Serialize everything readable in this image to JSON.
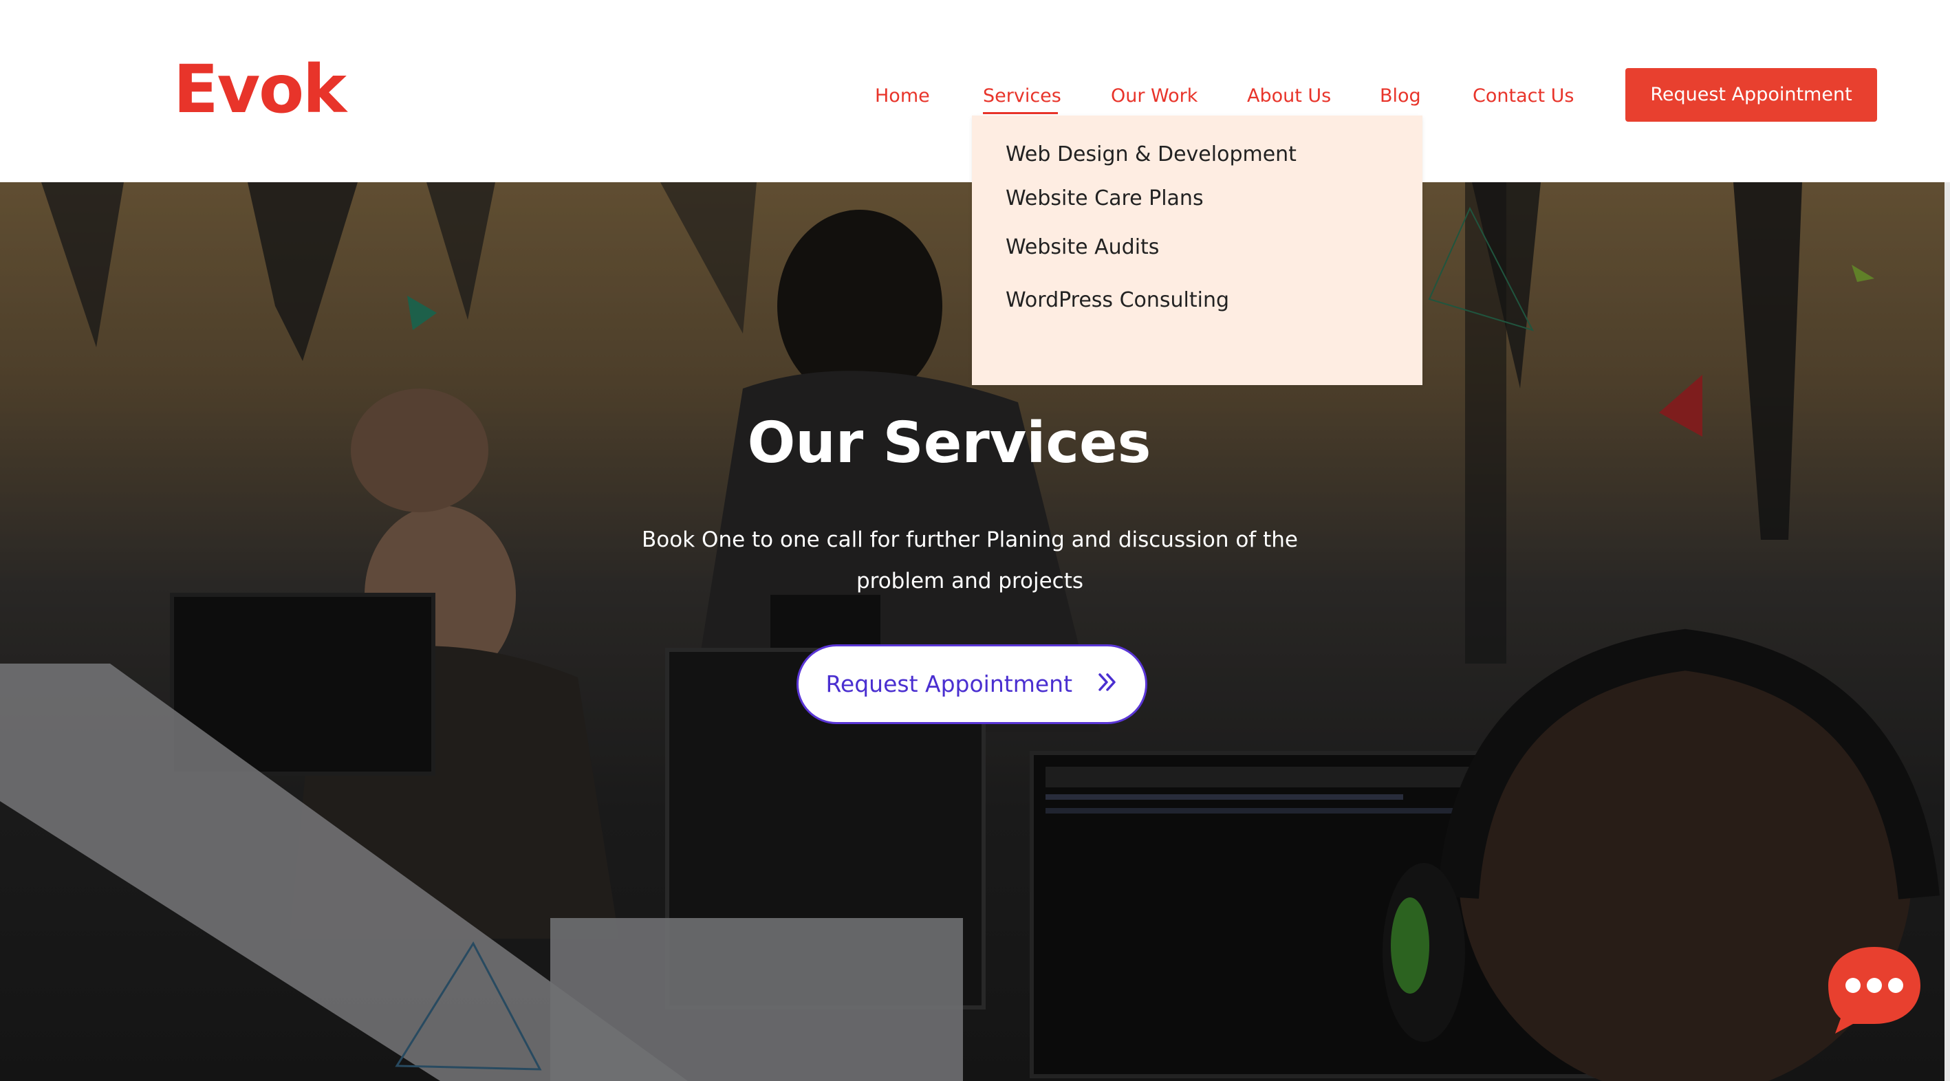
{
  "brand": {
    "logo": "Evok",
    "accent_color": "#e8342a"
  },
  "nav": {
    "items": [
      {
        "label": "Home"
      },
      {
        "label": "Services"
      },
      {
        "label": "Our Work"
      },
      {
        "label": "About Us"
      },
      {
        "label": "Blog"
      },
      {
        "label": "Contact Us"
      }
    ],
    "active": "Services",
    "cta_label": "Request  Appointment"
  },
  "dropdown": {
    "items": [
      {
        "label": "Web Design & Development"
      },
      {
        "label": "Website Care Plans"
      },
      {
        "label": "Website Audits"
      },
      {
        "label": "WordPress Consulting"
      }
    ],
    "background": "#feede2"
  },
  "hero": {
    "title": "Our Services",
    "subtitle": "Book One to one call for further Planing and discussion of the problem and projects",
    "cta_label": "Request Appointment",
    "cta_icon": "double-chevron-right-icon",
    "cta_color": "#4a2fd0"
  },
  "chat": {
    "icon": "chat-bubble-icon",
    "color": "#e8402f"
  }
}
